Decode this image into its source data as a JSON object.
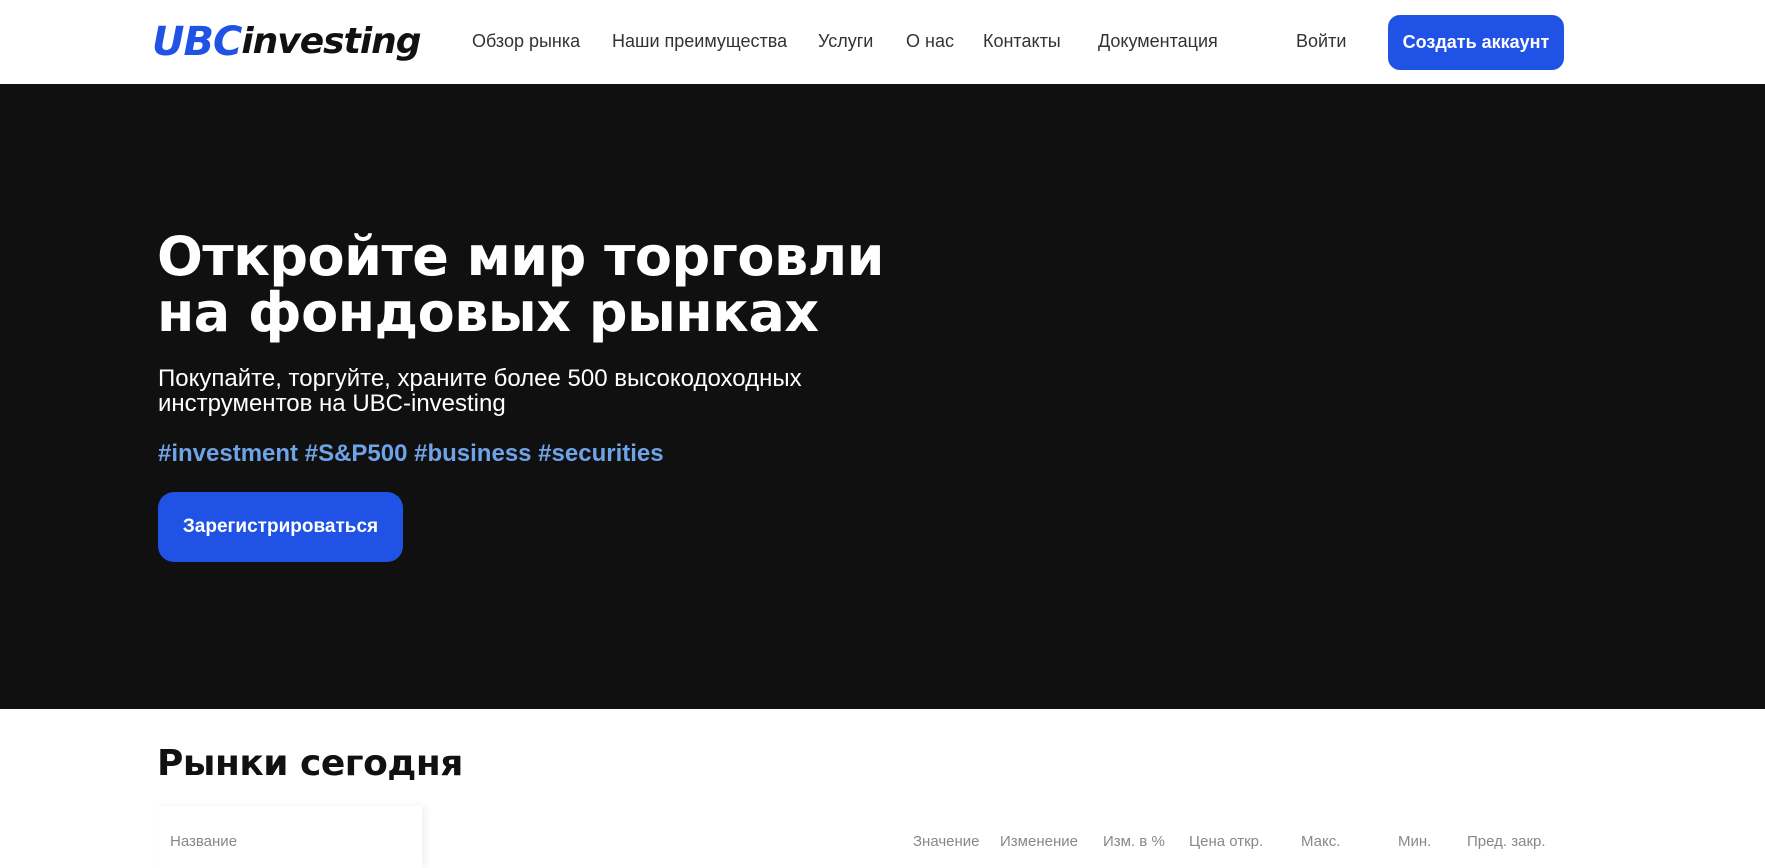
{
  "header": {
    "logo_ubc": "UBC",
    "logo_investing": "investing",
    "nav": [
      {
        "label": "Обзор рынка"
      },
      {
        "label": "Наши преимущества"
      },
      {
        "label": "Услуги"
      },
      {
        "label": "О нас"
      },
      {
        "label": "Контакты"
      },
      {
        "label": "Документация"
      }
    ],
    "login_label": "Войти",
    "create_account_label": "Создать аккаунт"
  },
  "hero": {
    "title_line1": "Откройте мир торговли",
    "title_line2": "на фондовых рынках",
    "subtitle": "Покупайте, торгуйте, храните более 500 высокодоходных инструментов на UBC-investing",
    "tags": "#investment #S&P500 #business #securities",
    "register_label": "Зарегистрироваться"
  },
  "markets": {
    "title": "Рынки сегодня",
    "columns": [
      "Название",
      "Значение",
      "Изменение",
      "Изм. в %",
      "Цена откр.",
      "Макс.",
      "Мин.",
      "Пред. закр."
    ]
  },
  "colors": {
    "accent": "#2152e6",
    "hero_bg": "#101010",
    "tags": "#6fa3e8"
  }
}
